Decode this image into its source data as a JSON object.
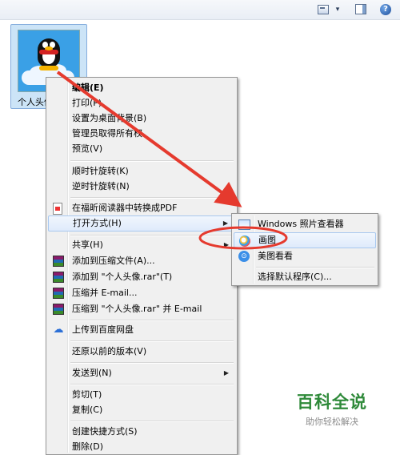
{
  "toolbar": {
    "caret": "▾",
    "help": "?"
  },
  "file": {
    "label": "个人头像"
  },
  "context_menu": {
    "items": [
      {
        "label": "编辑(E)",
        "bold": true
      },
      {
        "label": "打印(P)"
      },
      {
        "label": "设置为桌面背景(B)"
      },
      {
        "label": "管理员取得所有权"
      },
      {
        "label": "预览(V)"
      },
      {
        "label": "顺时针旋转(K)"
      },
      {
        "label": "逆时针旋转(N)"
      },
      {
        "label": "在福昕阅读器中转换成PDF",
        "icon": "pdf-icon"
      },
      {
        "label": "打开方式(H)",
        "submenu": true,
        "highlighted": true
      },
      {
        "label": "共享(H)",
        "submenu": true
      },
      {
        "label": "添加到压缩文件(A)...",
        "icon": "winrar-icon"
      },
      {
        "label": "添加到 \"个人头像.rar\"(T)",
        "icon": "winrar-icon"
      },
      {
        "label": "压缩并 E-mail...",
        "icon": "winrar-icon"
      },
      {
        "label": "压缩到 \"个人头像.rar\" 并 E-mail",
        "icon": "winrar-icon"
      },
      {
        "label": "上传到百度网盘",
        "icon": "baidu-cloud-icon"
      },
      {
        "label": "还原以前的版本(V)"
      },
      {
        "label": "发送到(N)",
        "submenu": true
      },
      {
        "label": "剪切(T)"
      },
      {
        "label": "复制(C)"
      },
      {
        "label": "创建快捷方式(S)"
      },
      {
        "label": "删除(D)"
      }
    ]
  },
  "open_with_menu": {
    "items": [
      {
        "label": "Windows 照片查看器",
        "icon": "photo-viewer-icon"
      },
      {
        "label": "画图",
        "icon": "paint-icon",
        "highlighted": true
      },
      {
        "label": "美图看看",
        "icon": "meitu-icon"
      },
      {
        "label": "选择默认程序(C)..."
      }
    ]
  },
  "annotation": {
    "color": "#e53a2e"
  },
  "watermark": {
    "title": "百科全说",
    "subtitle": "助你轻松解决",
    "color": "#2f8a3a"
  }
}
